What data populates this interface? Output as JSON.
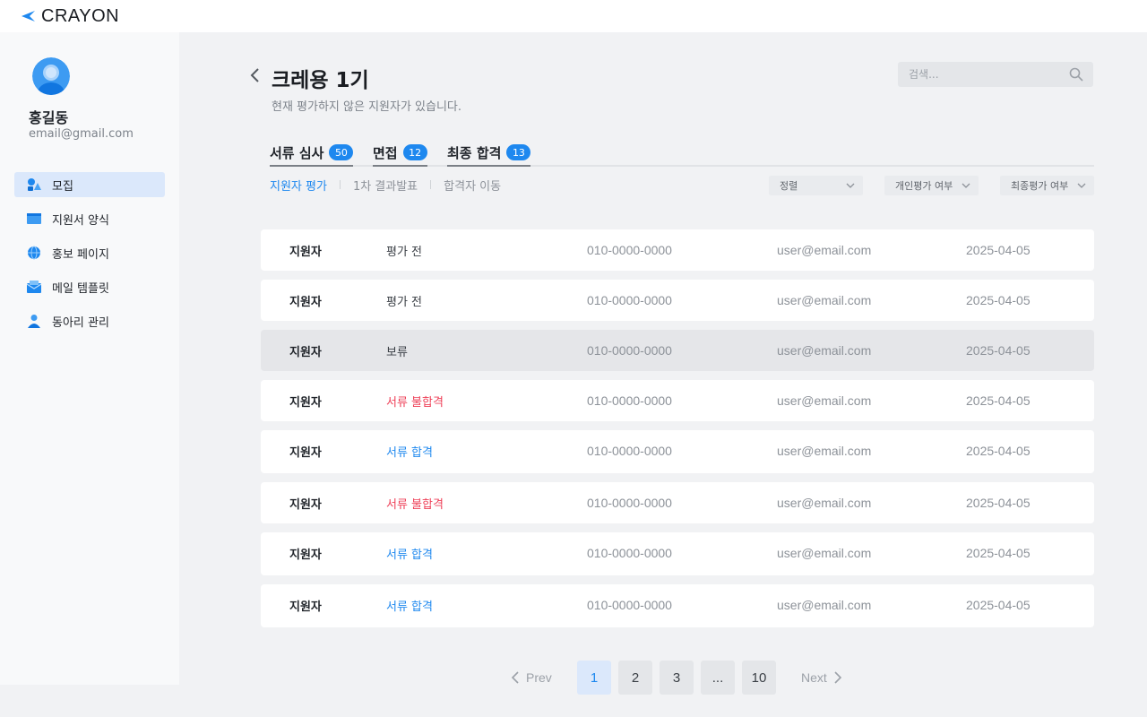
{
  "app": {
    "logo_text": "CRAYON",
    "brand_color": "#1e88ef"
  },
  "user": {
    "name": "홍길동",
    "email": "email@gmail.com"
  },
  "sidebar": {
    "items": [
      {
        "label": "모집",
        "icon": "recruit-icon",
        "active": true
      },
      {
        "label": "지원서 양식",
        "icon": "form-icon",
        "active": false
      },
      {
        "label": "홍보 페이지",
        "icon": "globe-icon",
        "active": false
      },
      {
        "label": "메일 템플릿",
        "icon": "mail-icon",
        "active": false
      },
      {
        "label": "동아리 관리",
        "icon": "people-icon",
        "active": false
      }
    ]
  },
  "header": {
    "title": "크레용 1기",
    "subtitle": "현재 평가하지 않은 지원자가 있습니다.",
    "search_placeholder": "검색..."
  },
  "tabs": [
    {
      "label": "서류 심사",
      "count": "50"
    },
    {
      "label": "면접",
      "count": "12"
    },
    {
      "label": "최종 합격",
      "count": "13"
    }
  ],
  "subtabs": [
    {
      "label": "지원자 평가",
      "active": true
    },
    {
      "label": "1차 결과발표",
      "active": false
    },
    {
      "label": "합격자 이동",
      "active": false
    }
  ],
  "filters": [
    {
      "label": "정렬"
    },
    {
      "label": "개인평가 여부"
    },
    {
      "label": "최종평가 여부"
    }
  ],
  "status_colors": {
    "pending": "#3a3f45",
    "fail": "#ee3f57",
    "pass": "#1e88ef"
  },
  "rows": [
    {
      "name": "지원자",
      "status": "평가 전",
      "status_type": "pending",
      "phone": "010-0000-0000",
      "email": "user@email.com",
      "date": "2025-04-05"
    },
    {
      "name": "지원자",
      "status": "평가 전",
      "status_type": "pending",
      "phone": "010-0000-0000",
      "email": "user@email.com",
      "date": "2025-04-05"
    },
    {
      "name": "지원자",
      "status": "보류",
      "status_type": "pending",
      "phone": "010-0000-0000",
      "email": "user@email.com",
      "date": "2025-04-05"
    },
    {
      "name": "지원자",
      "status": "서류 불합격",
      "status_type": "fail",
      "phone": "010-0000-0000",
      "email": "user@email.com",
      "date": "2025-04-05"
    },
    {
      "name": "지원자",
      "status": "서류 합격",
      "status_type": "pass",
      "phone": "010-0000-0000",
      "email": "user@email.com",
      "date": "2025-04-05"
    },
    {
      "name": "지원자",
      "status": "서류 불합격",
      "status_type": "fail",
      "phone": "010-0000-0000",
      "email": "user@email.com",
      "date": "2025-04-05"
    },
    {
      "name": "지원자",
      "status": "서류 합격",
      "status_type": "pass",
      "phone": "010-0000-0000",
      "email": "user@email.com",
      "date": "2025-04-05"
    },
    {
      "name": "지원자",
      "status": "서류 합격",
      "status_type": "pass",
      "phone": "010-0000-0000",
      "email": "user@email.com",
      "date": "2025-04-05"
    }
  ],
  "pagination": {
    "prev_label": "Prev",
    "next_label": "Next",
    "pages": [
      "1",
      "2",
      "3",
      "...",
      "10"
    ],
    "current": "1"
  }
}
